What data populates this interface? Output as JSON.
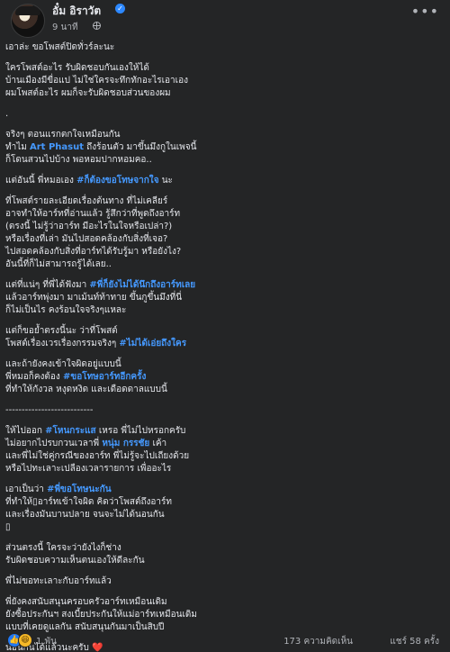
{
  "author": {
    "name": "อั๋ม อิราวัต",
    "verified_icon": "verified-badge-icon",
    "time": "9 นาที",
    "audience_icon": "globe-icon"
  },
  "menu_icon": "more-options-icon",
  "post": {
    "line_1": "เอาล่ะ ขอโพสต์ปิดทั่วร์ละนะ",
    "line_2": "ใครโพสต์อะไร รับผิดชอบกันเองให้ได้",
    "line_3": "บ้านเมืองมีขื่อแป ไม่ใช่ใครจะทึกทักอะไรเอาเอง",
    "line_4": "ผมโพสต์อะไร ผมก็จะรับผิดชอบส่วนของผม",
    "line_5": ".",
    "line_6": "จริงๆ ตอนแรกตกใจเหมือนกัน",
    "line_7_a": "ทำไม ",
    "line_7_mention": "Art Phasut",
    "line_7_b": " ถึงร้อนตัว มาขึ้นมึงกูในเพจนี้",
    "line_8": "ก็โดนสวนไปบ้าง พอหอมปากหอมคอ..",
    "line_9_a": "แต่อันนี้ พี่หมอเอง ",
    "line_9_tag": "#ก็ต้องขอโทษจากใจ",
    "line_9_b": " นะ",
    "line_10": "ที่โพสต์รายละเอียดเรื่องต้นทาง ที่ไม่เคลียร์",
    "line_11": "อาจทำให้อาร์ทที่อ่านแล้ว รู้สึกว่าที่พูดถึงอาร์ท",
    "line_12": "(ตรงนี้ ไม่รู้ว่าอาร์ท มีอะไรในใจหรือเปล่า?)",
    "line_13": "หรือเรื่องที่เล่า มันไปสอดคล้องกับสิ่งที่เจอ?",
    "line_14": "ไปสอดคล้องกับสิ่งที่อาร์ทได้รับรู้มา หรือยังไง?",
    "line_15": "อันนี้ที่ก็ไม่สามารถรู้ได้เลย..",
    "line_16_a": "แต่ที่แน่ๆ ที่พี่ได้ฟังมา ",
    "line_16_tag": "#พี่ก็ยังไม่ได้นึกถึงอาร์ทเลย",
    "line_17": "แล้วอาร์ทพุ่งมา มาเม้นท์ท้าทาย ขึ้นกูขึ้นมึงที่นี่",
    "line_18": "ก็ไม่เป็นไร คงร้อนใจจริงๆแหละ",
    "line_19": "แต่ก็ขอย้ำตรงนี้นะ ว่าที่โพสต์",
    "line_20_a": "โพสต์เรื่องเวรเรื่องกรรมจริงๆ ",
    "line_20_tag": "#ไม่ได้เอ่ยถึงใคร",
    "line_21": "และถ้ายังคงเข้าใจผิดอยู่แบบนี้",
    "line_22_a": "พี่หมอก็คงต้อง ",
    "line_22_tag": "#ขอโทษอาร์ทอีกครั้ง",
    "line_23": "ที่ทำให้กังวล หงุดหงิด และเดือดดาลแบบนี้",
    "divider": "---------------------------",
    "line_24_a": "ให้ไปออก ",
    "line_24_tag": "#โหนกระแส",
    "line_24_b": " เหรอ พี่ไม่ไปหรอกครับ",
    "line_25_a": "ไม่อยากไปรบกวนเวลาพี่ ",
    "line_25_mention": "หนุ่ม กรรชัย",
    "line_25_b": " เค้า",
    "line_26": "และพี่ไม่ใช่คู่กรณีของอาร์ท พี่ไม่รู้จะไปเถียงด้วย",
    "line_27": "หรือไปทะเลาะเปลืองเวลารายการ เพื่ออะไร",
    "line_28_a": "เอาเป็นว่า ",
    "line_28_tag": "#พี่ขอโทษนะกัน",
    "line_29": "ที่ทำให้▯อาร์ทเข้าใจผิด คิดว่าโพสต์ถึงอาร์ท",
    "line_30": "และเรื่องมันบานปลาย จนจะไม่ได้นอนกัน",
    "line_31": "▯",
    "line_32": "ส่วนตรงนี้ ใครจะว่ายังไงก็ช่าง",
    "line_33": "รับผิดชอบความเห็นตนเองให้ดีละกัน",
    "line_34": "พี่ไม่ขอทะเลาะกับอาร์ทแล้ว",
    "line_35": "พี่ยังคงสนับสนุนครอบครัวอาร์ทเหมือนเดิม",
    "line_36": "ยังซื้อประกันฯ สงเบี้ยประกันให้แม่อาร์ทเหมือนเดิม",
    "line_37": "แบบที่เคยดูแลกัน สนับสนุนกันมาเป็นสิบปี",
    "line_38": "นอนกันได้แล้วนะครับ",
    "line_38_heart": "❤️"
  },
  "footer": {
    "reaction_icons": [
      "like-icon",
      "haha-icon"
    ],
    "reaction_count": "1 พัน",
    "comment_count": "173 ความคิดเห็น",
    "share_count": "แชร์ 58 ครั้ง"
  }
}
